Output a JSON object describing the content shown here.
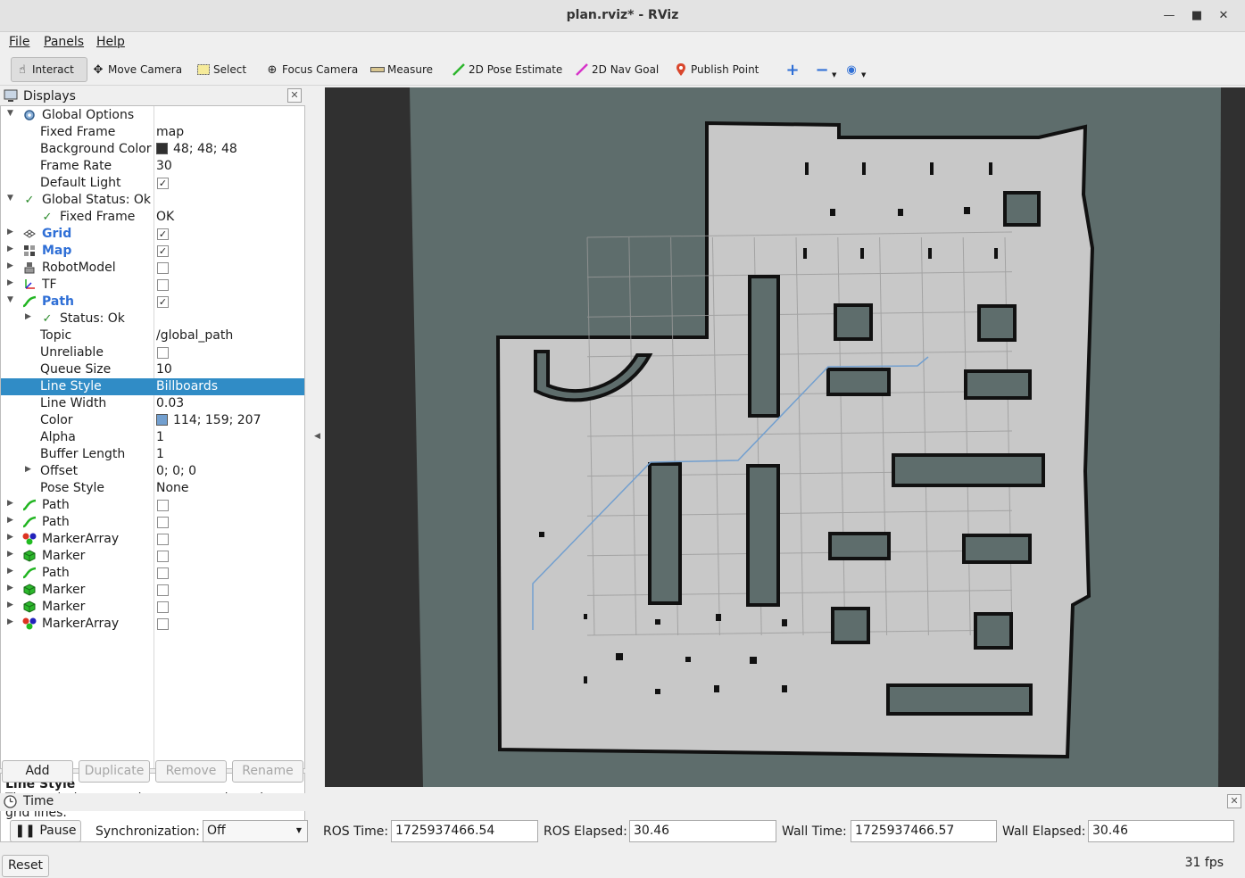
{
  "window": {
    "title": "plan.rviz* - RViz"
  },
  "menu": [
    "File",
    "Panels",
    "Help"
  ],
  "toolbar": {
    "interact": "Interact",
    "move_camera": "Move Camera",
    "select": "Select",
    "focus_camera": "Focus Camera",
    "measure": "Measure",
    "pose_estimate": "2D Pose Estimate",
    "nav_goal": "2D Nav Goal",
    "publish_point": "Publish Point"
  },
  "displays": {
    "title": "Displays",
    "rows": [
      {
        "name": "Global Options",
        "value": "",
        "icon": "gear-icon"
      },
      {
        "name": "Fixed Frame",
        "value": "map"
      },
      {
        "name": "Background Color",
        "value": "48; 48; 48",
        "swatch": "#303030"
      },
      {
        "name": "Frame Rate",
        "value": "30"
      },
      {
        "name": "Default Light",
        "value": "",
        "checked": true
      },
      {
        "name": "Global Status: Ok",
        "value": "",
        "icon": "check-icon"
      },
      {
        "name": "Fixed Frame",
        "value": "OK",
        "icon": "check-icon"
      },
      {
        "name": "Grid",
        "value": "",
        "checked": true,
        "icon": "grid-icon"
      },
      {
        "name": "Map",
        "value": "",
        "checked": true,
        "icon": "map-icon"
      },
      {
        "name": "RobotModel",
        "value": "",
        "checked": false,
        "icon": "robot-model-icon"
      },
      {
        "name": "TF",
        "value": "",
        "checked": false,
        "icon": "tf-icon"
      },
      {
        "name": "Path",
        "value": "",
        "checked": true,
        "icon": "path-icon"
      },
      {
        "name": "Status: Ok",
        "value": "",
        "icon": "check-icon"
      },
      {
        "name": "Topic",
        "value": "/global_path"
      },
      {
        "name": "Unreliable",
        "value": "",
        "checked": false
      },
      {
        "name": "Queue Size",
        "value": "10"
      },
      {
        "name": "Line Style",
        "value": "Billboards"
      },
      {
        "name": "Line Width",
        "value": "0.03"
      },
      {
        "name": "Color",
        "value": "114; 159; 207",
        "swatch": "#729fcf"
      },
      {
        "name": "Alpha",
        "value": "1"
      },
      {
        "name": "Buffer Length",
        "value": "1"
      },
      {
        "name": "Offset",
        "value": "0; 0; 0"
      },
      {
        "name": "Pose Style",
        "value": "None"
      },
      {
        "name": "Path",
        "value": "",
        "checked": false,
        "icon": "path-icon"
      },
      {
        "name": "Path",
        "value": "",
        "checked": false,
        "icon": "path-icon"
      },
      {
        "name": "MarkerArray",
        "value": "",
        "checked": false,
        "icon": "marker-array-icon"
      },
      {
        "name": "Marker",
        "value": "",
        "checked": false,
        "icon": "marker-icon"
      },
      {
        "name": "Path",
        "value": "",
        "checked": false,
        "icon": "path-icon"
      },
      {
        "name": "Marker",
        "value": "",
        "checked": false,
        "icon": "marker-icon"
      },
      {
        "name": "Marker",
        "value": "",
        "checked": false,
        "icon": "marker-icon"
      },
      {
        "name": "MarkerArray",
        "value": "",
        "checked": false,
        "icon": "marker-array-icon"
      }
    ]
  },
  "help": {
    "title": "Line Style",
    "text": "The rendering operation to use to draw the grid lines."
  },
  "buttons": {
    "add": "Add",
    "duplicate": "Duplicate",
    "remove": "Remove",
    "rename": "Rename"
  },
  "time": {
    "title": "Time",
    "pause": "Pause",
    "sync_label": "Synchronization:",
    "sync_value": "Off",
    "ros_time_label": "ROS Time:",
    "ros_time": "1725937466.54",
    "ros_elapsed_label": "ROS Elapsed:",
    "ros_elapsed": "30.46",
    "wall_time_label": "Wall Time:",
    "wall_time": "1725937466.57",
    "wall_elapsed_label": "Wall Elapsed:",
    "wall_elapsed": "30.46",
    "reset": "Reset",
    "fps": "31 fps"
  },
  "colors": {
    "background": "#303030",
    "map_unknown": "#5e6d6c",
    "map_free": "#c8c8c8",
    "map_occupied": "#000000",
    "path": "#729fcf",
    "selection": "#308cc6"
  }
}
